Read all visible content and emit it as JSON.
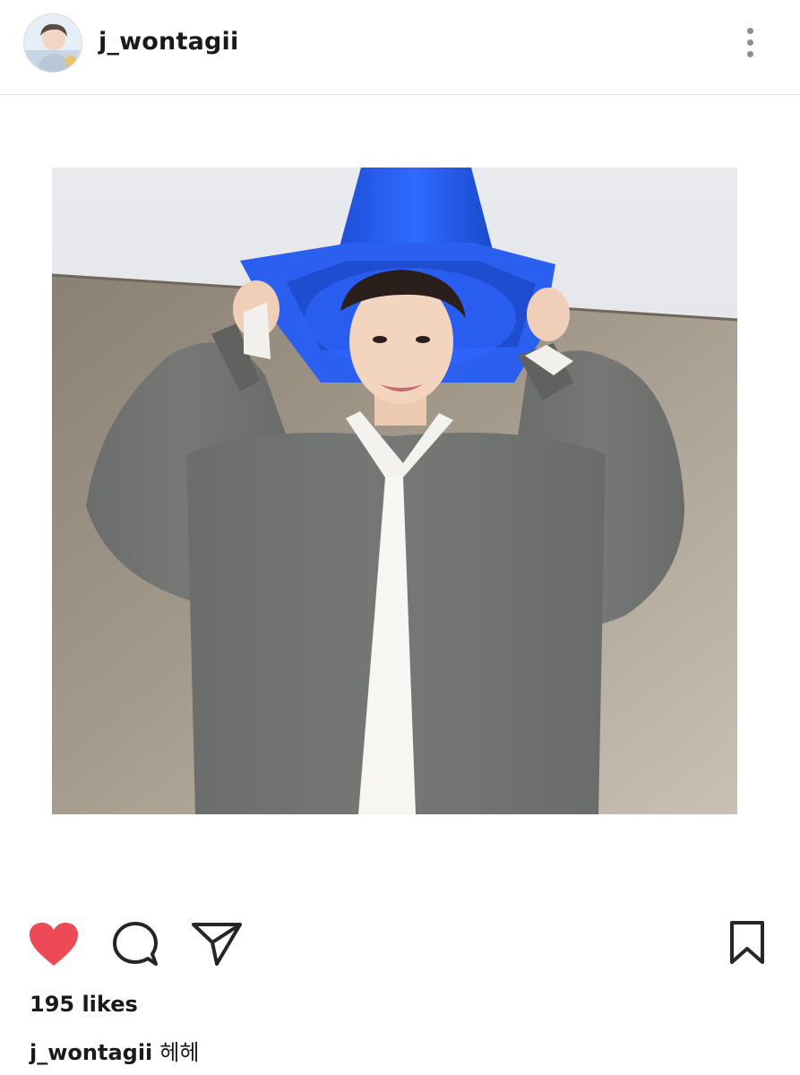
{
  "post": {
    "username": "j_wontagii",
    "likes_text": "195 likes",
    "caption": {
      "username": "j_wontagii",
      "text": "헤헤"
    },
    "liked": true,
    "colors": {
      "like_red": "#ed4956",
      "icon_dark": "#262626",
      "divider": "#e6e6e6"
    },
    "icons": {
      "like": "heart-icon",
      "comment": "comment-bubble-icon",
      "share": "paper-plane-icon",
      "save": "bookmark-icon",
      "more": "vertical-dots-icon"
    }
  }
}
